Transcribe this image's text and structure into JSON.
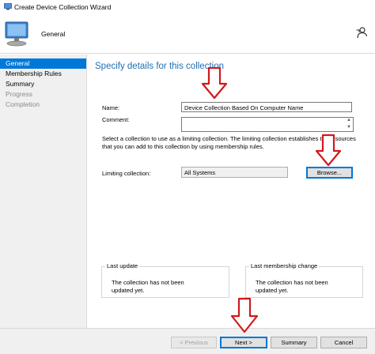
{
  "window": {
    "title": "Create Device Collection Wizard"
  },
  "header": {
    "page_name": "General"
  },
  "sidebar": {
    "items": [
      {
        "label": "General",
        "state": "active"
      },
      {
        "label": "Membership Rules",
        "state": "normal"
      },
      {
        "label": "Summary",
        "state": "normal"
      },
      {
        "label": "Progress",
        "state": "disabled"
      },
      {
        "label": "Completion",
        "state": "disabled"
      }
    ]
  },
  "main": {
    "title": "Specify details for this collection",
    "name_label": "Name:",
    "name_value": "Device Collection Based On Computer Name",
    "comment_label": "Comment:",
    "comment_value": "",
    "description": "Select a collection to use as a limiting collection. The limiting collection establishes the resources that you can add to this collection by using membership rules.",
    "limiting_label": "Limiting collection:",
    "limiting_value": "All Systems",
    "browse_label": "Browse...",
    "last_update": {
      "title": "Last update",
      "text": "The collection has not been updated yet."
    },
    "last_membership_change": {
      "title": "Last membership change",
      "text": "The collection has not been updated yet."
    }
  },
  "footer": {
    "previous_label": "< Previous",
    "next_label": "Next >",
    "summary_label": "Summary",
    "cancel_label": "Cancel"
  },
  "colors": {
    "accent": "#0078d7",
    "title_blue": "#1f6fb2",
    "annotation_red": "#d0191c"
  },
  "icons": [
    "wizard-app-icon",
    "computer-collection-icon",
    "help-person-icon",
    "annotation-arrow"
  ]
}
